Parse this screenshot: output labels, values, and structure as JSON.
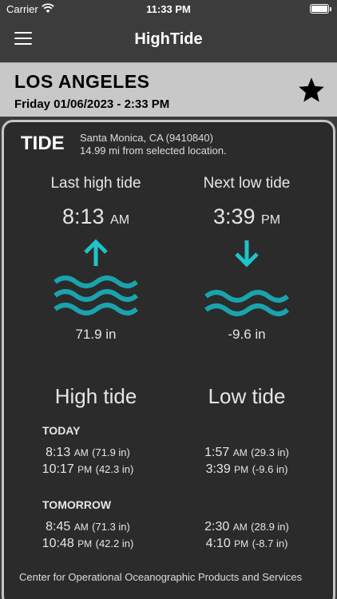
{
  "status": {
    "carrier": "Carrier",
    "time": "11:33 PM"
  },
  "nav": {
    "title": "HighTide"
  },
  "location": {
    "name": "LOS ANGELES",
    "datetime": "Friday 01/06/2023 - 2:33 PM"
  },
  "card": {
    "label": "TIDE",
    "station_line1": "Santa Monica, CA (9410840)",
    "station_line2": "14.99 mi from selected location."
  },
  "last_high": {
    "title": "Last high tide",
    "time": "8:13",
    "ampm": "AM",
    "height": "71.9 in",
    "arrow": "up-arrow-icon"
  },
  "next_low": {
    "title": "Next low tide",
    "time": "3:39",
    "ampm": "PM",
    "height": "-9.6 in",
    "arrow": "down-arrow-icon"
  },
  "high_tide_label": "High tide",
  "low_tide_label": "Low tide",
  "today": {
    "label": "TODAY",
    "high": [
      {
        "time": "8:13",
        "ampm": "AM",
        "height": "(71.9 in)"
      },
      {
        "time": "10:17",
        "ampm": "PM",
        "height": "(42.3 in)"
      }
    ],
    "low": [
      {
        "time": "1:57",
        "ampm": "AM",
        "height": "(29.3 in)"
      },
      {
        "time": "3:39",
        "ampm": "PM",
        "height": "(-9.6 in)"
      }
    ]
  },
  "tomorrow": {
    "label": "TOMORROW",
    "high": [
      {
        "time": "8:45",
        "ampm": "AM",
        "height": "(71.3 in)"
      },
      {
        "time": "10:48",
        "ampm": "PM",
        "height": "(42.2 in)"
      }
    ],
    "low": [
      {
        "time": "2:30",
        "ampm": "AM",
        "height": "(28.9 in)"
      },
      {
        "time": "4:10",
        "ampm": "PM",
        "height": "(-8.7 in)"
      }
    ]
  },
  "footer": "Center for Operational Oceanographic Products and Services",
  "colors": {
    "accent": "#1fc3c9",
    "wave": "#1aa3ad",
    "card_bg": "#2b2b2b",
    "header_bg": "#c8c8c8"
  }
}
